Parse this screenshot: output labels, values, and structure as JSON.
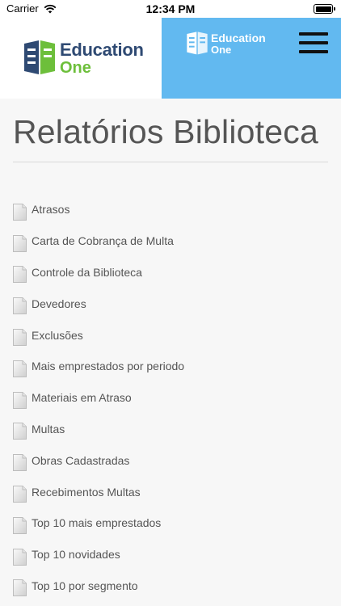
{
  "status_bar": {
    "carrier": "Carrier",
    "time": "12:34 PM"
  },
  "header": {
    "logo": {
      "line1": "Education",
      "line2": "One"
    },
    "logo_small": {
      "line1": "Education",
      "line2": "One"
    },
    "colors": {
      "header_right_bg": "#62b9f0",
      "logo_navy": "#2f4a73",
      "logo_green": "#6dbf3b"
    },
    "menu_icon": "hamburger-menu-icon"
  },
  "page": {
    "title": "Relatórios Biblioteca"
  },
  "reports": [
    {
      "label": "Atrasos"
    },
    {
      "label": "Carta de Cobrança de Multa"
    },
    {
      "label": "Controle da Biblioteca"
    },
    {
      "label": "Devedores"
    },
    {
      "label": "Exclusões"
    },
    {
      "label": "Mais emprestados por periodo"
    },
    {
      "label": "Materiais em Atraso"
    },
    {
      "label": "Multas"
    },
    {
      "label": "Obras Cadastradas"
    },
    {
      "label": "Recebimentos Multas"
    },
    {
      "label": "Top 10 mais emprestados"
    },
    {
      "label": "Top 10 novidades"
    },
    {
      "label": "Top 10 por segmento"
    }
  ],
  "report_icon": "document-icon"
}
